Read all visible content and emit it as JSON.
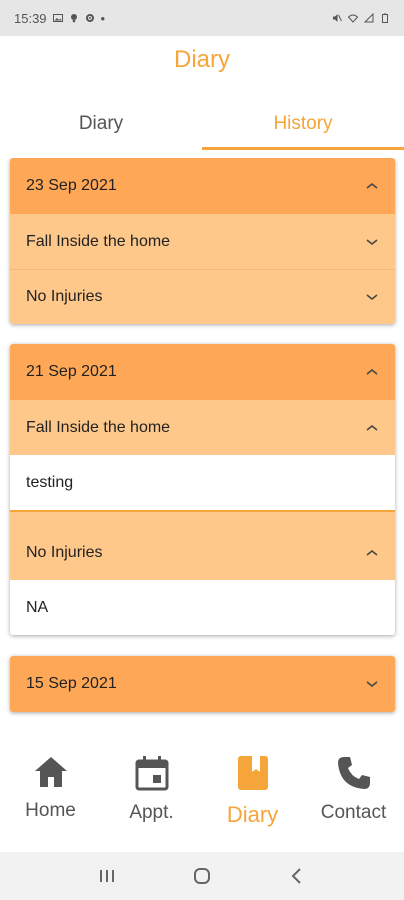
{
  "status_bar": {
    "time": "15:39",
    "dot": "•"
  },
  "app": {
    "title": "Diary",
    "accent_color": "#f5a53a"
  },
  "tabs": [
    {
      "label": "Diary",
      "active": false
    },
    {
      "label": "History",
      "active": true
    }
  ],
  "entries": [
    {
      "date": "23 Sep 2021",
      "expanded": true,
      "items": [
        {
          "label": "Fall Inside the home",
          "expanded": false
        },
        {
          "label": "No Injuries",
          "expanded": false
        }
      ]
    },
    {
      "date": "21 Sep 2021",
      "expanded": true,
      "items": [
        {
          "label": "Fall Inside the home",
          "expanded": true,
          "detail": "testing"
        },
        {
          "label": "No Injuries",
          "expanded": true,
          "detail": "NA"
        }
      ]
    },
    {
      "date": "15 Sep 2021",
      "expanded": false,
      "items": []
    }
  ],
  "bottom_nav": [
    {
      "label": "Home",
      "icon": "home-icon",
      "active": false
    },
    {
      "label": "Appt.",
      "icon": "calendar-icon",
      "active": false
    },
    {
      "label": "Diary",
      "icon": "book-icon",
      "active": true
    },
    {
      "label": "Contact",
      "icon": "phone-icon",
      "active": false
    }
  ],
  "system_nav": {
    "recents": "recents-icon",
    "home": "home-circle-icon",
    "back": "back-icon"
  }
}
